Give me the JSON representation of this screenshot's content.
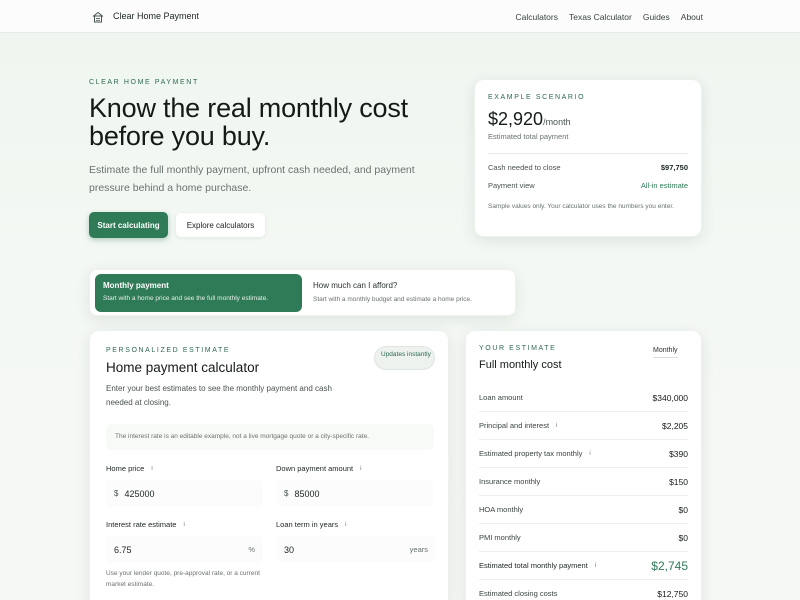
{
  "nav": {
    "brand": "Clear Home Payment",
    "links": [
      "Calculators",
      "Texas Calculator",
      "Guides",
      "About"
    ]
  },
  "hero": {
    "eyebrow": "CLEAR HOME PAYMENT",
    "title": "Know the real monthly cost before you buy.",
    "subtitle": "Estimate the full monthly payment, upfront cash needed, and payment pressure behind a home purchase.",
    "primary_button": "Start calculating",
    "secondary_button": "Explore calculators"
  },
  "scenario": {
    "eyebrow": "EXAMPLE SCENARIO",
    "amount": "$2,920",
    "per": "/month",
    "caption": "Estimated total payment",
    "rows": [
      {
        "label": "Cash needed to close",
        "value": "$97,750"
      },
      {
        "label": "Payment view",
        "value": "All-in estimate"
      }
    ],
    "note": "Sample values only. Your calculator uses the numbers you enter."
  },
  "modes": [
    {
      "title": "Monthly payment",
      "desc": "Start with a home price and see the full monthly estimate."
    },
    {
      "title": "How much can I afford?",
      "desc": "Start with a monthly budget and estimate a home price."
    }
  ],
  "calculator": {
    "eyebrow": "PERSONALIZED ESTIMATE",
    "title": "Home payment calculator",
    "badge": "Updates instantly",
    "desc": "Enter your best estimates to see the monthly payment and cash needed at closing.",
    "note": "The interest rate is an editable example, not a live mortgage quote or a city-specific rate.",
    "fields": {
      "home_price": {
        "label": "Home price",
        "prefix": "$",
        "value": "425000"
      },
      "down_payment": {
        "label": "Down payment amount",
        "prefix": "$",
        "value": "85000"
      },
      "interest_rate": {
        "label": "Interest rate estimate",
        "value": "6.75",
        "suffix": "%"
      },
      "loan_term": {
        "label": "Loan term in years",
        "value": "30",
        "suffix": "years"
      }
    },
    "help": "Use your lender quote, pre-approval rate, or a current market estimate."
  },
  "estimate": {
    "eyebrow": "YOUR ESTIMATE",
    "title": "Full monthly cost",
    "toggle": "Monthly",
    "rows": [
      {
        "label": "Loan amount",
        "value": "$340,000",
        "info": false
      },
      {
        "label": "Principal and interest",
        "value": "$2,205",
        "info": true
      },
      {
        "label": "Estimated property tax monthly",
        "value": "$390",
        "info": true
      },
      {
        "label": "Insurance monthly",
        "value": "$150",
        "info": false
      },
      {
        "label": "HOA monthly",
        "value": "$0",
        "info": false
      },
      {
        "label": "PMI monthly",
        "value": "$0",
        "info": false
      },
      {
        "label": "Estimated total monthly payment",
        "value": "$2,745",
        "info": true
      },
      {
        "label": "Estimated closing costs",
        "value": "$12,750",
        "info": false
      }
    ]
  },
  "colors": {
    "accent": "#2f7a57"
  }
}
